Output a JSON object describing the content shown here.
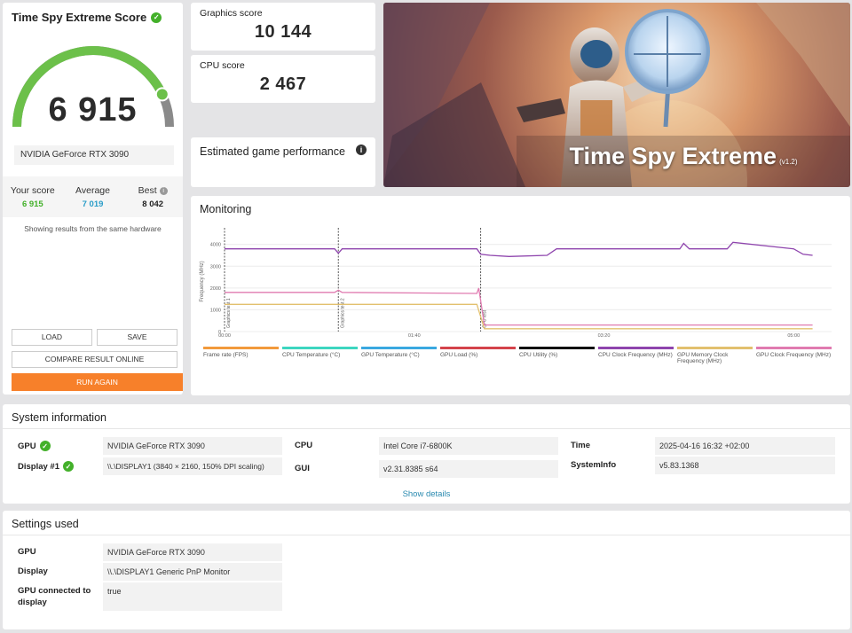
{
  "score_card": {
    "title": "Time Spy Extreme Score",
    "score": "6 915",
    "gpu": "NVIDIA GeForce RTX 3090",
    "your_score_label": "Your score",
    "your_score": "6 915",
    "average_label": "Average",
    "average": "7 019",
    "best_label": "Best",
    "best": "8 042",
    "same_hardware": "Showing results from the same hardware",
    "gauge_fraction": 0.86,
    "buttons": {
      "load": "LOAD",
      "save": "SAVE",
      "compare": "COMPARE RESULT ONLINE",
      "run_again": "RUN AGAIN"
    }
  },
  "graphics": {
    "label": "Graphics score",
    "value": "10 144"
  },
  "cpu": {
    "label": "CPU score",
    "value": "2 467"
  },
  "estimated": {
    "title": "Estimated game performance"
  },
  "banner": {
    "title": "Time Spy Extreme",
    "version": "(v1.2)"
  },
  "monitoring": {
    "title": "Monitoring"
  },
  "chart_data": {
    "type": "line",
    "ylabel": "Frequency (MHz)",
    "y_ticks": [
      "0",
      "1000",
      "2000",
      "3000",
      "4000"
    ],
    "ylim": [
      0,
      4600
    ],
    "x_ticks": [
      "00:00",
      "01:40",
      "03:20",
      "05:00"
    ],
    "xlim": [
      0,
      320
    ],
    "markers": [
      {
        "label": "Graphics test 1",
        "x": 0
      },
      {
        "label": "Graphics test 2",
        "x": 60
      },
      {
        "label": "CPU test",
        "x": 135
      }
    ],
    "series": [
      {
        "name": "Frame rate (FPS)",
        "color": "#f29a3c",
        "values": []
      },
      {
        "name": "CPU Temperature (°C)",
        "color": "#3dd6c0",
        "values": []
      },
      {
        "name": "GPU Temperature (°C)",
        "color": "#3aa8e0",
        "values": []
      },
      {
        "name": "GPU Load (%)",
        "color": "#d4434b",
        "values": []
      },
      {
        "name": "CPU Utility (%)",
        "color": "#111111",
        "values": []
      },
      {
        "name": "CPU Clock Frequency (MHz)",
        "color": "#8e44ad",
        "x": [
          0,
          58,
          60,
          62,
          133,
          135,
          140,
          150,
          170,
          175,
          240,
          242,
          245,
          265,
          268,
          300,
          305,
          310
        ],
        "values": [
          3800,
          3800,
          3600,
          3800,
          3800,
          3550,
          3500,
          3450,
          3500,
          3800,
          3800,
          4050,
          3800,
          3800,
          4100,
          3800,
          3550,
          3500
        ]
      },
      {
        "name": "GPU Memory Clock Frequency (MHz)",
        "color": "#e2c06e",
        "x": [
          0,
          133,
          137,
          310
        ],
        "values": [
          1250,
          1250,
          130,
          130
        ]
      },
      {
        "name": "GPU Clock Frequency (MHz)",
        "color": "#e07bb0",
        "x": [
          0,
          58,
          60,
          62,
          133,
          134,
          137,
          310
        ],
        "values": [
          1800,
          1800,
          1900,
          1800,
          1750,
          2000,
          300,
          300
        ]
      }
    ]
  },
  "sysinfo": {
    "title": "System information",
    "gpu_label": "GPU",
    "gpu": "NVIDIA GeForce RTX 3090",
    "display_label": "Display #1",
    "display": "\\\\.\\DISPLAY1 (3840 × 2160, 150% DPI scaling)",
    "cpu_label": "CPU",
    "cpu": "Intel Core i7-6800K",
    "gui_label": "GUI",
    "gui": "v2.31.8385 s64",
    "time_label": "Time",
    "time": "2025-04-16 16:32 +02:00",
    "systeminfo_label": "SystemInfo",
    "systeminfo": "v5.83.1368",
    "show_details": "Show details"
  },
  "settings": {
    "title": "Settings used",
    "gpu_label": "GPU",
    "gpu": "NVIDIA GeForce RTX 3090",
    "display_label": "Display",
    "display": "\\\\.\\DISPLAY1 Generic PnP Monitor",
    "connected_label": "GPU connected to display",
    "connected": "true"
  },
  "colors": {
    "accent_orange": "#f7802a",
    "score_green": "#43b02a",
    "average_blue": "#2a9dc8"
  }
}
